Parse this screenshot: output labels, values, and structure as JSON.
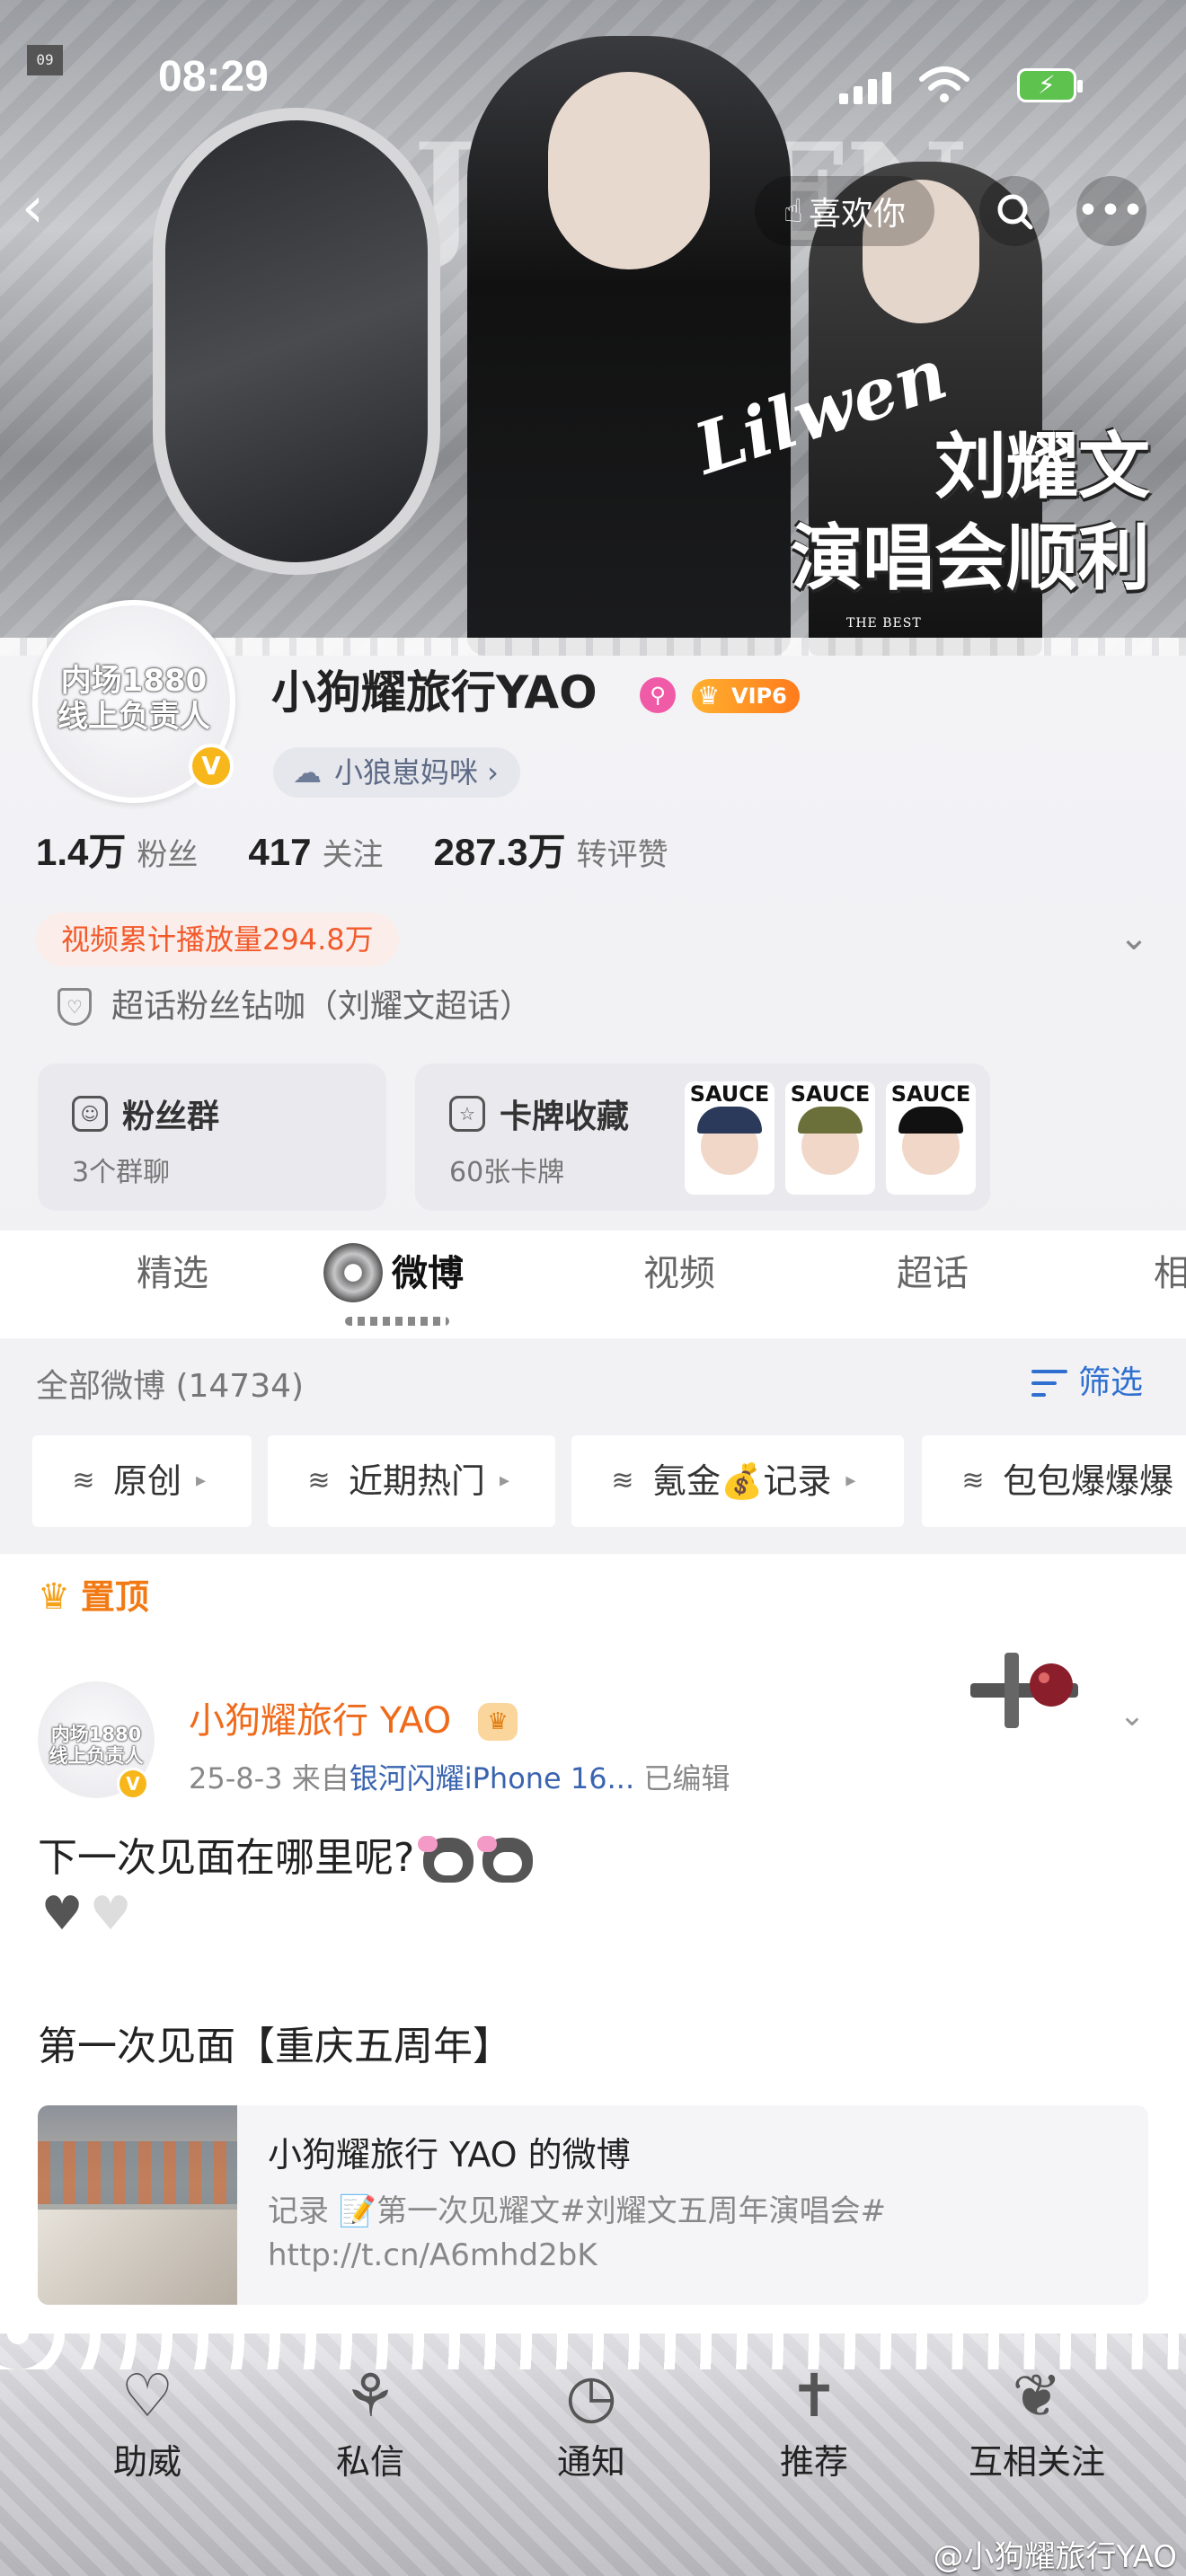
{
  "status": {
    "time": "08:29"
  },
  "nav": {
    "back_glyph": "‹",
    "like_label": "喜欢你",
    "more_glyph": "•••"
  },
  "hero": {
    "corner_code": "09",
    "headline_line1": "刘耀文",
    "headline_line2": "演唱会顺利",
    "script_text": "Lilwen",
    "the_best": "THE BEST",
    "big_letters": "LJL WEN"
  },
  "profile": {
    "avatar_line1": "内场1880",
    "avatar_line2": "线上负责人",
    "username": "小狗耀旅行YAO",
    "vip_label": "VIP6",
    "tag_label": "小狼崽妈咪 ›",
    "stats": [
      {
        "num": "1.4万",
        "label": "粉丝"
      },
      {
        "num": "417",
        "label": "关注"
      },
      {
        "num": "287.3万",
        "label": "转评赞"
      }
    ],
    "play_count": "视频累计播放量294.8万",
    "supertalk": "超话粉丝钻咖（刘耀文超话）",
    "fans_group": {
      "title": "粉丝群",
      "sub": "3个群聊"
    },
    "card_collection": {
      "title": "卡牌收藏",
      "sub": "60张卡牌",
      "sticker_label": "SAUCE"
    }
  },
  "tabs": [
    "精选",
    "微博",
    "视频",
    "超话",
    "相"
  ],
  "feed": {
    "all_label": "全部微博 (14734)",
    "filter_label": "筛选",
    "chips": [
      "原创",
      "近期热门",
      "氪金💰记录",
      "包包爆爆爆"
    ]
  },
  "post": {
    "pinned_label": "置顶",
    "author": "小狗耀旅行 YAO",
    "meta_date": "25-8-3",
    "meta_from": "来自",
    "meta_source": "银河闪耀iPhone 16...",
    "meta_edited": "已编辑",
    "text_line1": "下一次见面在哪里呢?",
    "text_line3": "第一次见面【重庆五周年】",
    "link_title": "小狗耀旅行 YAO 的微博",
    "link_desc": "记录 📝第一次见耀文#刘耀文五周年演唱会# http://t.cn/A6mhd2bK"
  },
  "bottom": {
    "items": [
      "助威",
      "私信",
      "通知",
      "推荐",
      "互相关注"
    ],
    "watermark": "@小狗耀旅行YAO"
  },
  "colors": {
    "accent_orange": "#f25a2c",
    "link_blue": "#2f6fd0",
    "vip": "#ff9a1f"
  }
}
